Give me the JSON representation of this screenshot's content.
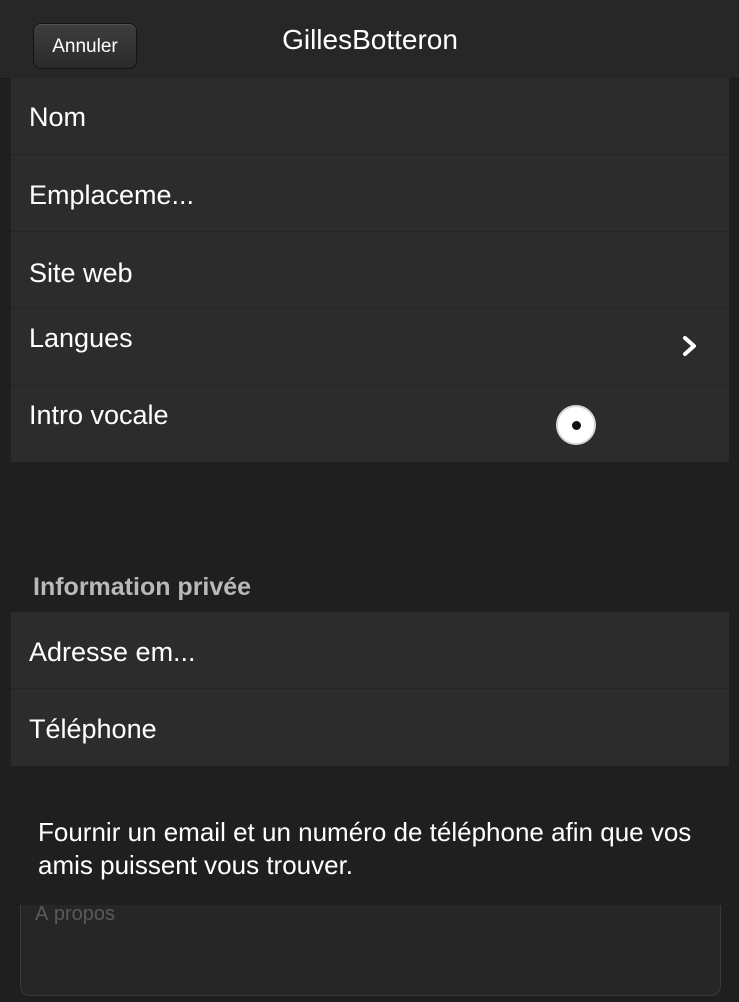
{
  "navbar": {
    "cancel_label": "Annuler",
    "title": "GillesBotteron"
  },
  "public_fields": [
    {
      "label": "Nom"
    },
    {
      "label": "Emplaceme..."
    },
    {
      "label": "Site web"
    },
    {
      "label": "Langues",
      "accessory": "chevron-right-icon"
    },
    {
      "label": "Intro vocale",
      "accessory": "record-icon"
    }
  ],
  "private_section": {
    "header": "Information privée",
    "fields": [
      {
        "label": "Adresse em..."
      },
      {
        "label": "Téléphone"
      }
    ],
    "hint": "Fournir un email et un numéro de téléphone afin que vos amis puissent vous trouver."
  },
  "about": {
    "placeholder": "À propos"
  },
  "colors": {
    "background": "#1f1f1f",
    "cell": "#2c2c2c",
    "text": "#ffffff",
    "section_header": "#b9b9b9"
  }
}
